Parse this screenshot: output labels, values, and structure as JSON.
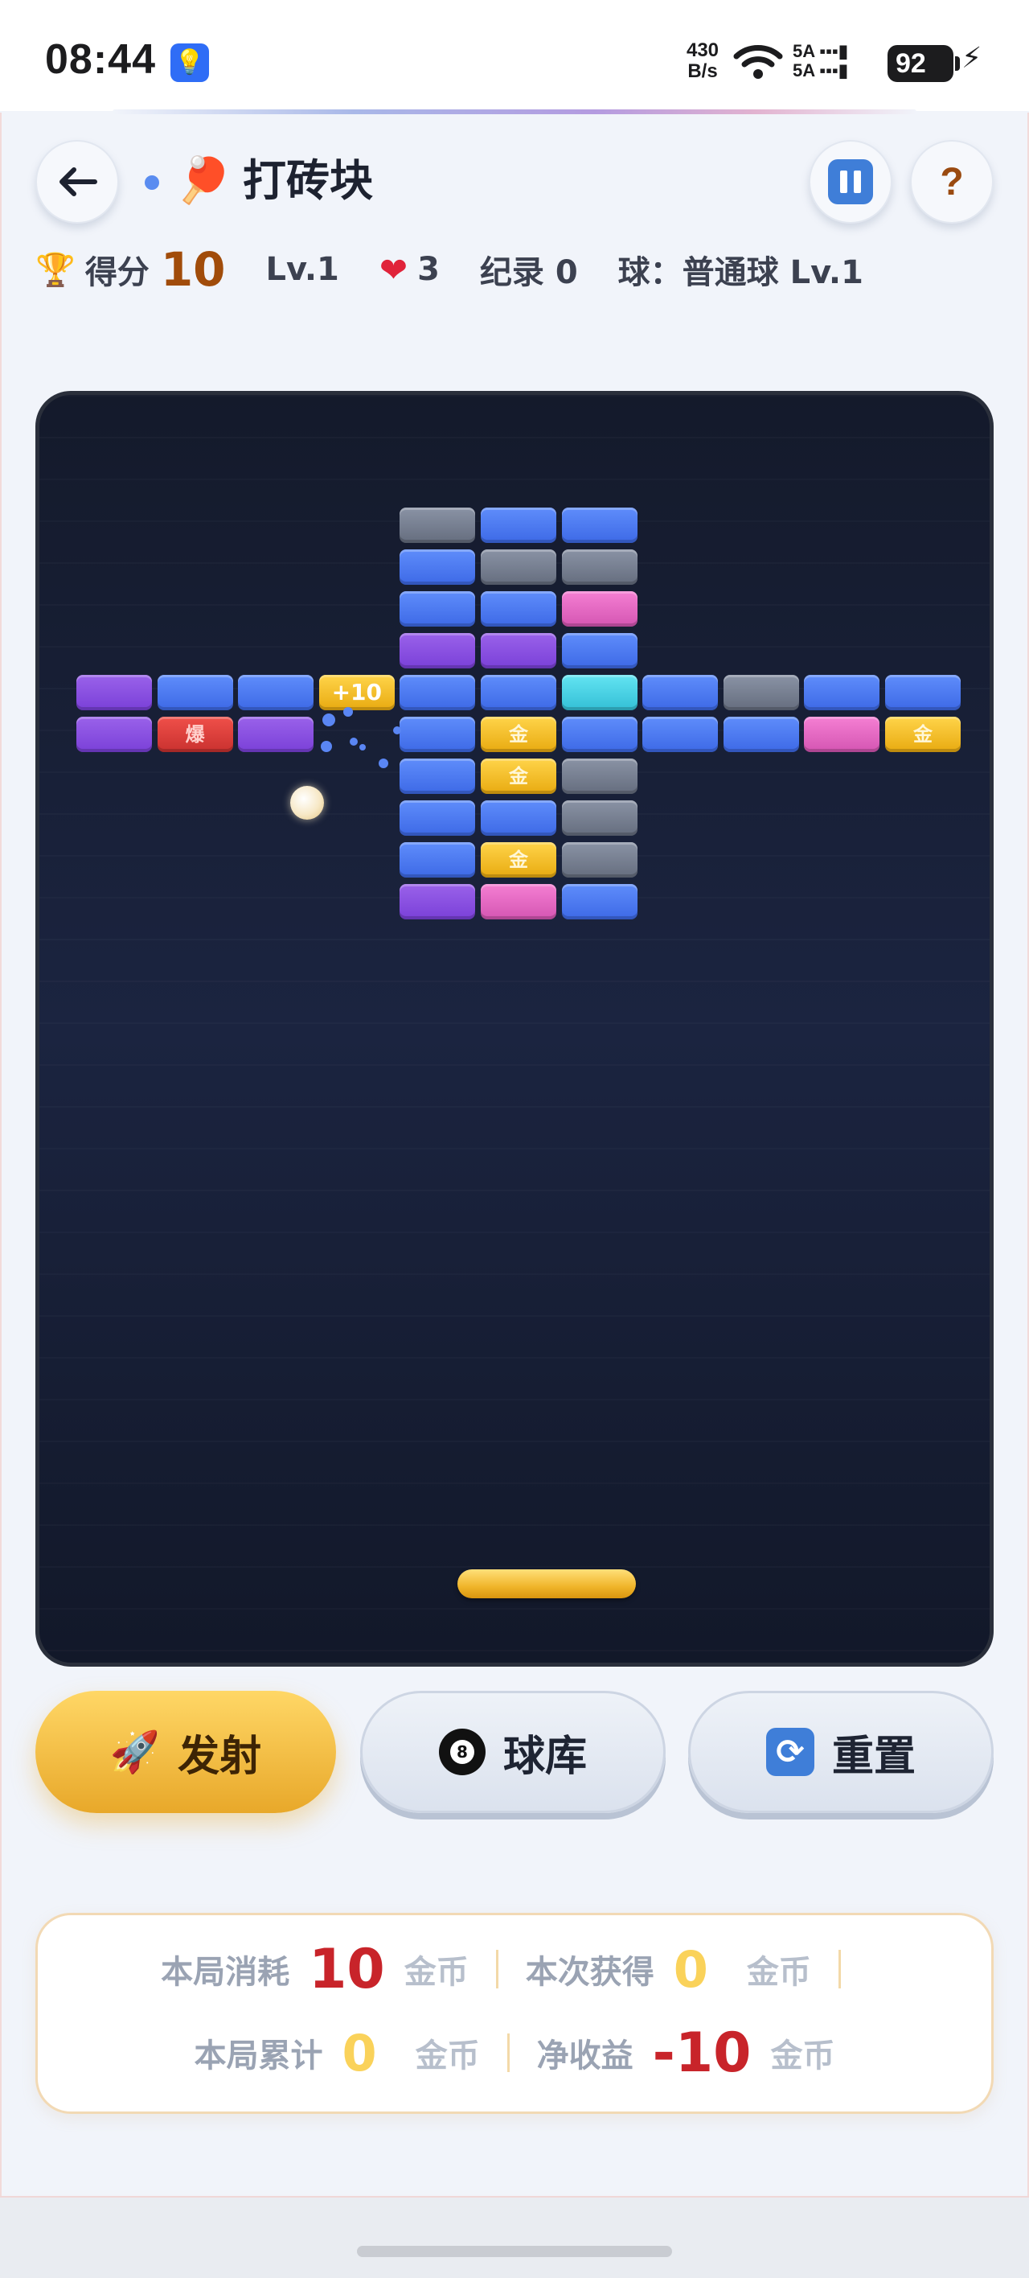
{
  "status_bar": {
    "time": "08:44",
    "notification_icon": "bulb-icon",
    "net_speed_value": "430",
    "net_speed_unit": "B/s",
    "sim1": "5A",
    "sim2": "5A",
    "battery": "92"
  },
  "header": {
    "title": "打砖块",
    "title_emoji": "🏓",
    "back_icon": "arrow-left-icon",
    "pause_icon": "pause-icon",
    "help_label": "?"
  },
  "stats": {
    "score_label": "得分",
    "score": "10",
    "level": "Lv.1",
    "lives": "3",
    "record": "纪录 0",
    "ball_type": "球：普通球 Lv.1"
  },
  "board": {
    "bonus_text": "+10",
    "bricks": [
      {
        "row": 0,
        "col": 4,
        "color": "gray"
      },
      {
        "row": 0,
        "col": 5,
        "color": "blue"
      },
      {
        "row": 0,
        "col": 6,
        "color": "blue"
      },
      {
        "row": 1,
        "col": 4,
        "color": "blue"
      },
      {
        "row": 1,
        "col": 5,
        "color": "gray"
      },
      {
        "row": 1,
        "col": 6,
        "color": "gray"
      },
      {
        "row": 2,
        "col": 4,
        "color": "blue"
      },
      {
        "row": 2,
        "col": 5,
        "color": "blue"
      },
      {
        "row": 2,
        "col": 6,
        "color": "pink"
      },
      {
        "row": 3,
        "col": 4,
        "color": "purple"
      },
      {
        "row": 3,
        "col": 5,
        "color": "purple"
      },
      {
        "row": 3,
        "col": 6,
        "color": "blue"
      },
      {
        "row": 4,
        "col": 0,
        "color": "purple"
      },
      {
        "row": 4,
        "col": 1,
        "color": "blue"
      },
      {
        "row": 4,
        "col": 2,
        "color": "blue"
      },
      {
        "row": 4,
        "col": 3,
        "color": "bonus",
        "label": "+10"
      },
      {
        "row": 4,
        "col": 4,
        "color": "blue"
      },
      {
        "row": 4,
        "col": 5,
        "color": "blue"
      },
      {
        "row": 4,
        "col": 6,
        "color": "cyan"
      },
      {
        "row": 4,
        "col": 7,
        "color": "blue"
      },
      {
        "row": 4,
        "col": 8,
        "color": "gray"
      },
      {
        "row": 4,
        "col": 9,
        "color": "blue"
      },
      {
        "row": 4,
        "col": 10,
        "color": "blue"
      },
      {
        "row": 5,
        "col": 0,
        "color": "purple"
      },
      {
        "row": 5,
        "col": 1,
        "color": "red",
        "label": "爆"
      },
      {
        "row": 5,
        "col": 2,
        "color": "purple"
      },
      {
        "row": 5,
        "col": 4,
        "color": "blue"
      },
      {
        "row": 5,
        "col": 5,
        "color": "gold",
        "label": "金"
      },
      {
        "row": 5,
        "col": 6,
        "color": "blue"
      },
      {
        "row": 5,
        "col": 7,
        "color": "blue"
      },
      {
        "row": 5,
        "col": 8,
        "color": "blue"
      },
      {
        "row": 5,
        "col": 9,
        "color": "pink"
      },
      {
        "row": 5,
        "col": 10,
        "color": "gold",
        "label": "金"
      },
      {
        "row": 6,
        "col": 4,
        "color": "blue"
      },
      {
        "row": 6,
        "col": 5,
        "color": "gold",
        "label": "金"
      },
      {
        "row": 6,
        "col": 6,
        "color": "gray"
      },
      {
        "row": 7,
        "col": 4,
        "color": "blue"
      },
      {
        "row": 7,
        "col": 5,
        "color": "blue"
      },
      {
        "row": 7,
        "col": 6,
        "color": "gray"
      },
      {
        "row": 8,
        "col": 4,
        "color": "blue"
      },
      {
        "row": 8,
        "col": 5,
        "color": "gold",
        "label": "金"
      },
      {
        "row": 8,
        "col": 6,
        "color": "gray"
      },
      {
        "row": 9,
        "col": 4,
        "color": "purple"
      },
      {
        "row": 9,
        "col": 5,
        "color": "pink"
      },
      {
        "row": 9,
        "col": 6,
        "color": "blue"
      }
    ]
  },
  "actions": {
    "fire_label": "发射",
    "fire_icon": "rocket-icon",
    "library_label": "球库",
    "library_icon": "8-ball-icon",
    "reset_label": "重置",
    "reset_icon": "refresh-icon"
  },
  "economy": {
    "spent_label": "本局消耗",
    "spent_value": "10",
    "earned_label": "本次获得",
    "earned_value": "0",
    "total_label": "本局累计",
    "total_value": "0",
    "net_label": "净收益",
    "net_value": "-10",
    "unit": "金币"
  },
  "colors": {
    "accent_gold": "#e8a82a",
    "board_bg": "#1b2440",
    "danger_red": "#c8242a",
    "brick_blue": "#4a78ee"
  }
}
